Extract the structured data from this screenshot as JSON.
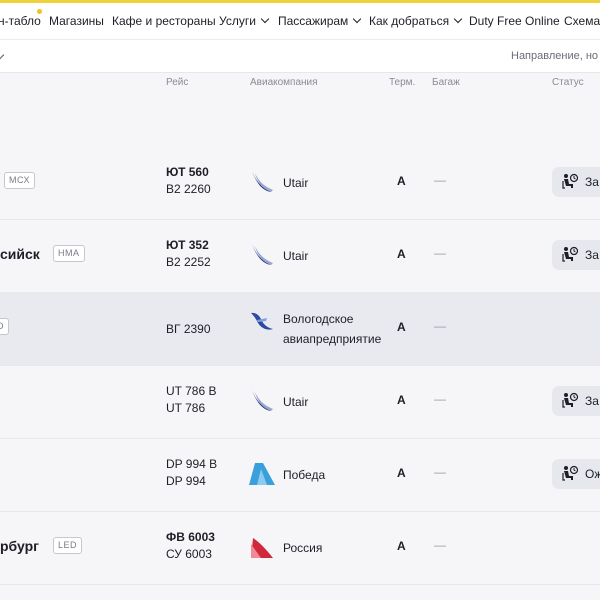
{
  "nav": {
    "items": [
      {
        "label": "н-табло",
        "dropdown": false
      },
      {
        "label": "Магазины",
        "dropdown": false
      },
      {
        "label": "Кафе и рестораны",
        "dropdown": false
      },
      {
        "label": "Услуги",
        "dropdown": true
      },
      {
        "label": "Пассажирам",
        "dropdown": true
      },
      {
        "label": "Как добраться",
        "dropdown": true
      },
      {
        "label": "Duty Free Online",
        "dropdown": false
      },
      {
        "label": "Схема",
        "dropdown": false
      }
    ]
  },
  "filter": {
    "direction_placeholder": "Направление, но"
  },
  "table": {
    "headers": {
      "flight": "Рейс",
      "airline": "Авиакомпания",
      "terminal": "Терм.",
      "baggage": "Багаж",
      "status": "Статус"
    },
    "rows": [
      {
        "dest": "",
        "code": "МСХ",
        "flights": [
          "ЮТ 560",
          "В2 2260"
        ],
        "airline": [
          "Utair"
        ],
        "logo": "utair-logo-icon",
        "terminal": "A",
        "baggage": "—",
        "status": "За"
      },
      {
        "dest": "сийск",
        "code": "НМА",
        "flights": [
          "ЮТ 352",
          "В2 2252"
        ],
        "airline": [
          "Utair"
        ],
        "logo": "utair-logo-icon",
        "terminal": "A",
        "baggage": "—",
        "status": "За"
      },
      {
        "dest": "",
        "code": "D",
        "flights": [
          "ВГ 2390"
        ],
        "airline": [
          "Вологодское",
          "авиапредприятие"
        ],
        "logo": "vologda-airline-logo-icon",
        "terminal": "A",
        "baggage": "—",
        "status": ""
      },
      {
        "dest": "",
        "code": "",
        "flights": [
          "UT 786 B",
          "UT 786"
        ],
        "airline": [
          "Utair"
        ],
        "logo": "utair-logo-icon",
        "terminal": "A",
        "baggage": "—",
        "status": "За"
      },
      {
        "dest": "",
        "code": "",
        "flights": [
          "DP 994 B",
          "DP 994"
        ],
        "airline": [
          "Победа"
        ],
        "logo": "pobeda-logo-icon",
        "terminal": "A",
        "baggage": "—",
        "status": "Ож"
      },
      {
        "dest": "рбург",
        "code": "LED",
        "flights": [
          "ФВ 6003",
          "СУ 6003"
        ],
        "airline": [
          "Россия"
        ],
        "logo": "rossiya-logo-icon",
        "terminal": "A",
        "baggage": "—",
        "status": ""
      }
    ]
  },
  "colors": {
    "accent_stripe": "#f0d23c",
    "utair_blue": "#1c2f7a",
    "pobeda_blue": "#3aa0dc",
    "rossiya_red": "#d2283c",
    "row_alt": "#e9e9f0"
  }
}
